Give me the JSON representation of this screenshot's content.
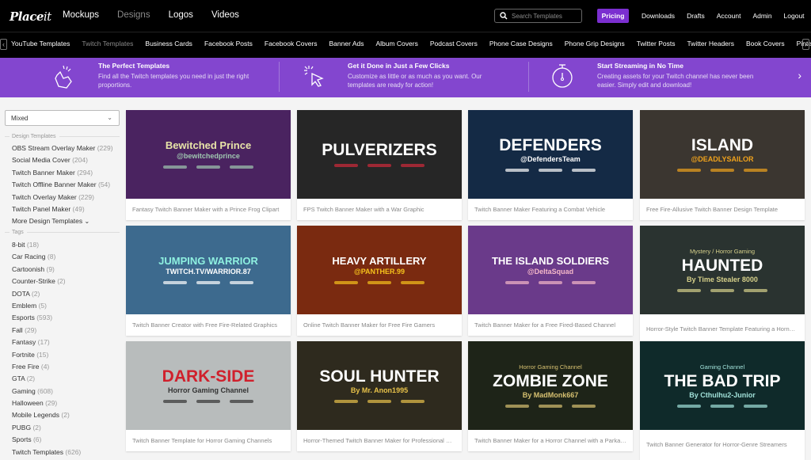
{
  "header": {
    "logo_bold": "Place",
    "logo_light": "it",
    "nav": [
      "Mockups",
      "Designs",
      "Logos",
      "Videos"
    ],
    "active_nav": "Designs",
    "search_placeholder": "Search Templates",
    "pricing_label": "Pricing",
    "right_nav": [
      "Downloads",
      "Drafts",
      "Account",
      "Admin",
      "Logout"
    ],
    "accent_color": "#7b2fd0"
  },
  "categories": {
    "items": [
      "YouTube Templates",
      "Twitch Templates",
      "Business Cards",
      "Facebook Posts",
      "Facebook Covers",
      "Banner Ads",
      "Album Covers",
      "Podcast Covers",
      "Phone Case Designs",
      "Phone Grip Designs",
      "Twitter Posts",
      "Twitter Headers",
      "Book Covers",
      "Pinterest Pins"
    ],
    "active": "Twitch Templates"
  },
  "promo": {
    "background": "#8346cf",
    "items": [
      {
        "icon": "hand-snap-icon",
        "title": "The Perfect Templates",
        "desc": "Find all the Twitch templates you need in just the right proportions."
      },
      {
        "icon": "cursor-click-icon",
        "title": "Get it Done in Just a Few Clicks",
        "desc": "Customize as little or as much as you want. Our templates are ready for action!"
      },
      {
        "icon": "stopwatch-icon",
        "title": "Start Streaming in No Time",
        "desc": "Creating assets for your Twitch channel has never been easier. Simply edit and download!"
      }
    ]
  },
  "sidebar": {
    "sort_value": "Mixed",
    "design_templates_heading": "Design Templates",
    "design_templates": [
      {
        "label": "OBS Stream Overlay Maker",
        "count": "(229)"
      },
      {
        "label": "Social Media Cover",
        "count": "(204)"
      },
      {
        "label": "Twitch Banner Maker",
        "count": "(294)"
      },
      {
        "label": "Twitch Offline Banner Maker",
        "count": "(54)"
      },
      {
        "label": "Twitch Overlay Maker",
        "count": "(229)"
      },
      {
        "label": "Twitch Panel Maker",
        "count": "(49)"
      }
    ],
    "more_label": "More Design Templates",
    "tags_heading": "Tags",
    "tags": [
      {
        "label": "8-bit",
        "count": "(18)"
      },
      {
        "label": "Car Racing",
        "count": "(8)"
      },
      {
        "label": "Cartoonish",
        "count": "(9)"
      },
      {
        "label": "Counter-Strike",
        "count": "(2)"
      },
      {
        "label": "DOTA",
        "count": "(2)"
      },
      {
        "label": "Emblem",
        "count": "(5)"
      },
      {
        "label": "Esports",
        "count": "(593)"
      },
      {
        "label": "Fall",
        "count": "(29)"
      },
      {
        "label": "Fantasy",
        "count": "(17)"
      },
      {
        "label": "Fortnite",
        "count": "(15)"
      },
      {
        "label": "Free Fire",
        "count": "(4)"
      },
      {
        "label": "GTA",
        "count": "(2)"
      },
      {
        "label": "Gaming",
        "count": "(608)"
      },
      {
        "label": "Halloween",
        "count": "(29)"
      },
      {
        "label": "Mobile Legends",
        "count": "(2)"
      },
      {
        "label": "PUBG",
        "count": "(2)"
      },
      {
        "label": "Sports",
        "count": "(6)"
      },
      {
        "label": "Twitch Templates",
        "count": "(626)"
      }
    ]
  },
  "cards": [
    {
      "title": "Bewitched Prince",
      "handle": "@bewitchedprince",
      "caption": "Fantasy Twitch Banner Maker with a Prince Frog Clipart",
      "bg": "#4a2360",
      "fg": "#e8e4a8",
      "hc": "#9fc7b0"
    },
    {
      "title": "PULVERIZERS",
      "handle": "",
      "caption": "FPS Twitch Banner Maker with a War Graphic",
      "bg": "#262626",
      "fg": "#ffffff",
      "hc": "#d02a3a"
    },
    {
      "title": "DEFENDERS",
      "handle": "@DefendersTeam",
      "caption": "Twitch Banner Maker Featuring a Combat Vehicle",
      "bg": "#142a45",
      "fg": "#ffffff",
      "hc": "#ffffff"
    },
    {
      "title": "ISLAND",
      "handle": "@DEADLYSAILOR",
      "caption": "Free Fire-Allusive Twitch Banner Design Template",
      "bg": "#3b3630",
      "fg": "#ffffff",
      "hc": "#f0a21c"
    },
    {
      "title": "JUMPING WARRIOR",
      "handle": "TWITCH.TV/WARRIOR.87",
      "caption": "Twitch Banner Creator with Free Fire-Related Graphics",
      "bg": "#3d6a8e",
      "fg": "#8ef0e0",
      "hc": "#ffffff"
    },
    {
      "title": "HEAVY ARTILLERY",
      "handle": "@PANTHER.99",
      "caption": "Online Twitch Banner Maker for Free Fire Gamers",
      "bg": "#7a2a10",
      "fg": "#ffffff",
      "hc": "#f5c21c"
    },
    {
      "title": "THE ISLAND SOLDIERS",
      "handle": "@DeltaSquad",
      "caption": "Twitch Banner Maker for a Free Fired-Based Channel",
      "bg": "#6a3a8a",
      "fg": "#ffffff",
      "hc": "#f5b8c8"
    },
    {
      "title": "HAUNTED",
      "handle": "By Time Stealer 8000",
      "subtitle": "Mystery / Horror Gaming",
      "caption": "Horror-Style Twitch Banner Template Featuring a Horned ...",
      "bg": "#2a3330",
      "fg": "#ffffff",
      "hc": "#d6d08a"
    },
    {
      "title": "DARK-SIDE",
      "handle": "Horror Gaming Channel",
      "caption": "Twitch Banner Template for Horror Gaming Channels",
      "bg": "#b8bcbc",
      "fg": "#d0202c",
      "hc": "#333333"
    },
    {
      "title": "SOUL HUNTER",
      "handle": "By Mr. Anon1995",
      "caption": "Horror-Themed Twitch Banner Maker for Professional Ga...",
      "bg": "#2e2a1e",
      "fg": "#ffffff",
      "hc": "#e8c24a"
    },
    {
      "title": "ZOMBIE ZONE",
      "handle": "By MadMonk667",
      "subtitle": "Horror Gaming Channel",
      "caption": "Twitch Banner Maker for a Horror Channel with a Parka Cl...",
      "bg": "#1e2418",
      "fg": "#ffffff",
      "hc": "#d6c070"
    },
    {
      "title": "THE BAD TRIP",
      "handle": "By Cthulhu2-Junior",
      "subtitle": "Gaming Channel",
      "caption": "Twitch Banner Generator for Horror-Genre Streamers",
      "bg": "#0f2a2a",
      "fg": "#ffffff",
      "hc": "#a0e0d8"
    }
  ]
}
